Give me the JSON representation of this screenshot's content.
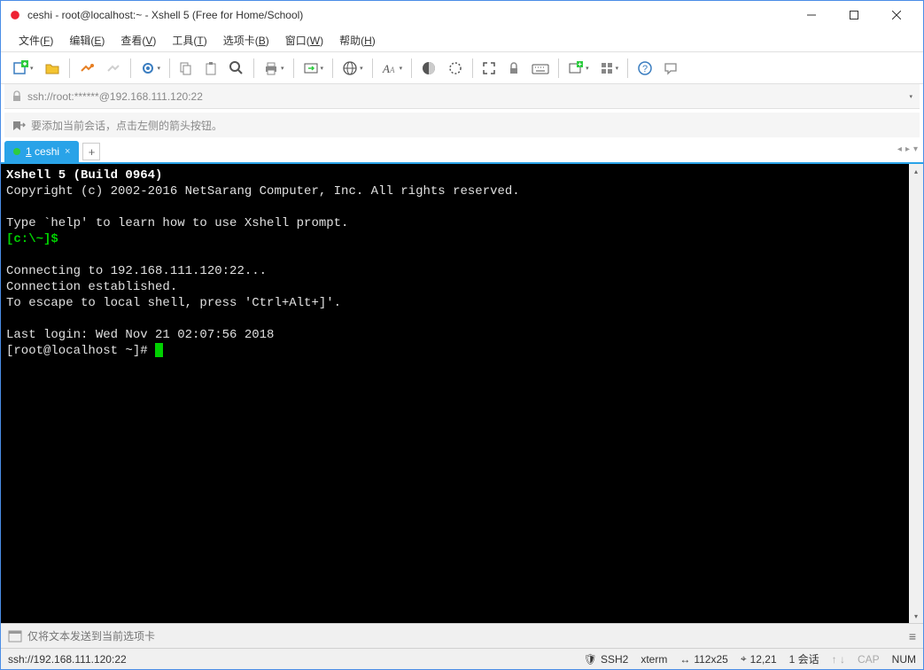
{
  "window": {
    "title": "ceshi - root@localhost:~ - Xshell 5 (Free for Home/School)"
  },
  "menu": {
    "file": "文件(F)",
    "edit": "编辑(E)",
    "view": "查看(V)",
    "tools": "工具(T)",
    "tabs": "选项卡(B)",
    "window": "窗口(W)",
    "help": "帮助(H)"
  },
  "address": {
    "url": "ssh://root:******@192.168.111.120:22"
  },
  "sessionHint": "要添加当前会话，点击左侧的箭头按钮。",
  "tab": {
    "label": "1 ceshi"
  },
  "terminal": {
    "line1": "Xshell 5 (Build 0964)",
    "line2": "Copyright (c) 2002-2016 NetSarang Computer, Inc. All rights reserved.",
    "line3": "Type `help' to learn how to use Xshell prompt.",
    "prompt1": "[c:\\~]$",
    "line4": "Connecting to 192.168.111.120:22...",
    "line5": "Connection established.",
    "line6": "To escape to local shell, press 'Ctrl+Alt+]'.",
    "line7": "Last login: Wed Nov 21 02:07:56 2018",
    "prompt2": "[root@localhost ~]# "
  },
  "inputbar": {
    "placeholder": "仅将文本发送到当前选项卡"
  },
  "status": {
    "left": "ssh://192.168.111.120:22",
    "proto": "SSH2",
    "term": "xterm",
    "size": "112x25",
    "pos": "12,21",
    "sessions": "1 会话",
    "cap": "CAP",
    "num": "NUM"
  }
}
